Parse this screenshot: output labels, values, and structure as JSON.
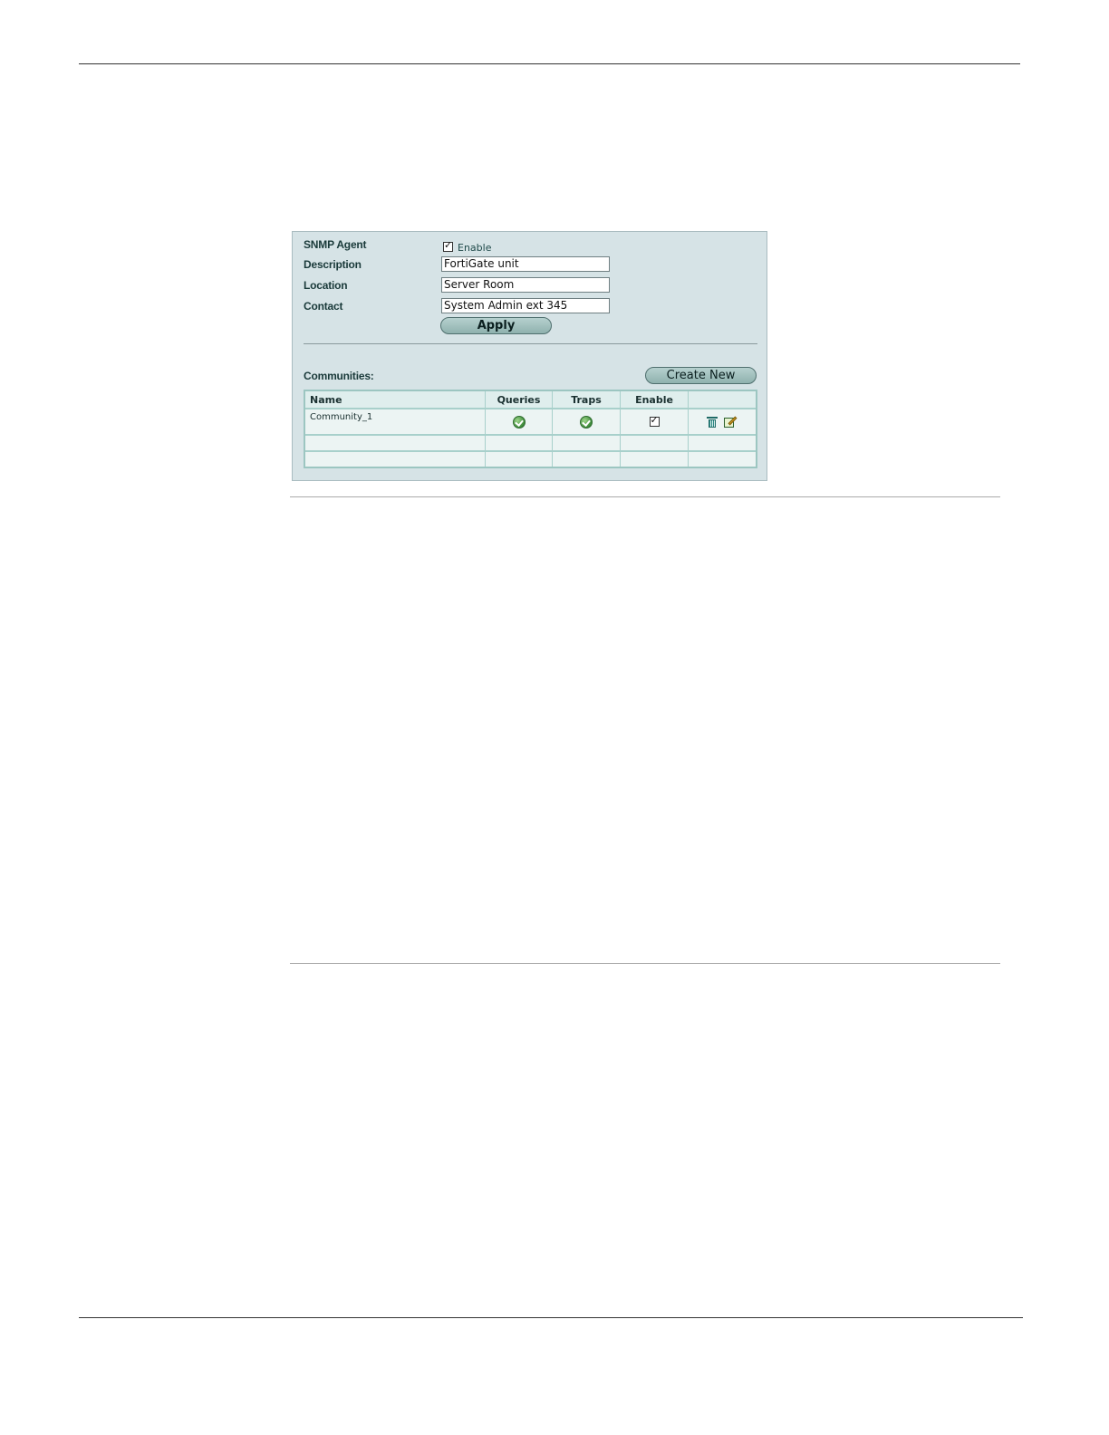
{
  "snmp": {
    "agent_label": "SNMP Agent",
    "agent_enable_label": "Enable",
    "agent_enabled": true,
    "description_label": "Description",
    "description_value": "FortiGate unit",
    "location_label": "Location",
    "location_value": "Server Room",
    "contact_label": "Contact",
    "contact_value": "System Admin ext 345",
    "apply_label": "Apply"
  },
  "communities": {
    "label": "Communities:",
    "create_new_label": "Create New",
    "columns": [
      "Name",
      "Queries",
      "Traps",
      "Enable",
      ""
    ],
    "rows": [
      {
        "name": "Community_1",
        "queries": true,
        "traps": true,
        "enable": true
      }
    ]
  },
  "icons": [
    "checkbox-checked-icon",
    "ok-icon",
    "trash-icon",
    "edit-icon"
  ],
  "colors": {
    "panel_bg": "#d6e3e6",
    "grid_border": "#9cc6c1",
    "button_bg": "#9fbfbd",
    "ok_green": "#3d8a3a"
  }
}
